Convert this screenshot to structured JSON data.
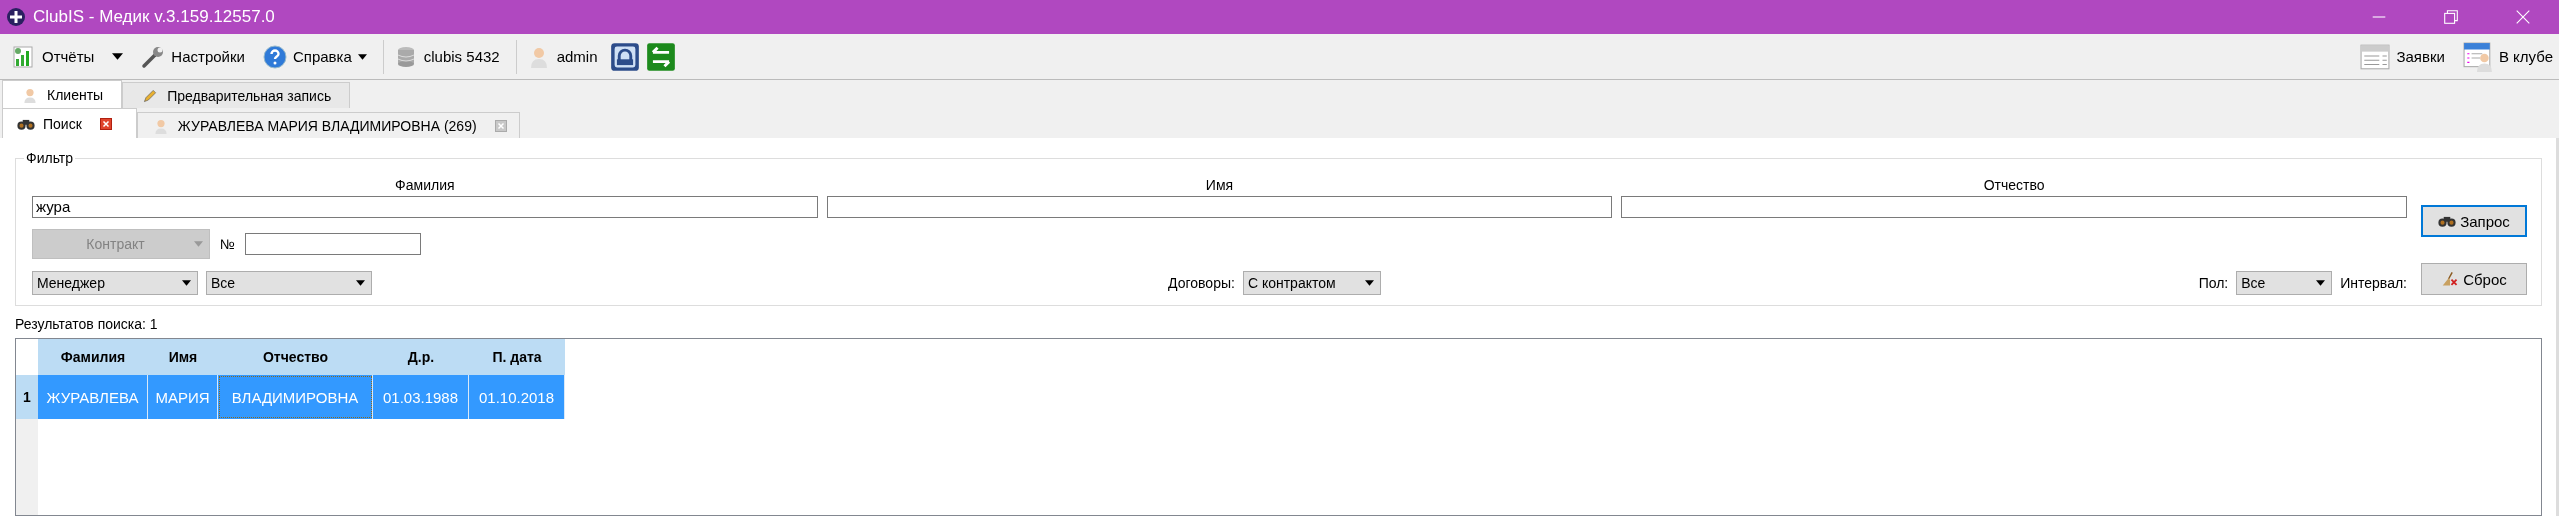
{
  "window": {
    "title": "ClubIS - Медик v.3.159.12557.0"
  },
  "toolbar": {
    "left": [
      {
        "label": "Отчёты",
        "dropdown": true
      },
      {
        "label": "Настройки",
        "dropdown": false
      },
      {
        "label": "Справка",
        "dropdown": true
      }
    ],
    "status": [
      {
        "label": "clubis 5432"
      },
      {
        "label": "admin"
      }
    ],
    "right": [
      {
        "label": "Заявки"
      },
      {
        "label": "В клубе"
      }
    ]
  },
  "main_tabs": [
    {
      "label": "Клиенты",
      "selected": true
    },
    {
      "label": "Предварительная запись",
      "selected": false
    }
  ],
  "sub_tabs": [
    {
      "label": "Поиск",
      "selected": true
    },
    {
      "label": "ЖУРАВЛЕВА МАРИЯ ВЛАДИМИРОВНА (269)",
      "selected": false
    }
  ],
  "filter": {
    "legend": "Фильтр",
    "name_fields": [
      {
        "label": "Фамилия",
        "value": "жура"
      },
      {
        "label": "Имя"
      },
      {
        "label": "Отчество"
      }
    ],
    "contract": {
      "value": "Контракт",
      "disabled": true
    },
    "number": {
      "label": "№"
    },
    "manager": {
      "value": "Менеджер"
    },
    "manager_scope": {
      "value": "Все"
    },
    "contracts": {
      "label": "Договоры:",
      "value": "С контрактом"
    },
    "gender": {
      "label": "Пол:",
      "value": "Все"
    },
    "interval": {
      "label": "Интервал:"
    },
    "buttons": [
      {
        "label": "Запрос",
        "focused": true
      },
      {
        "label": "Сброс",
        "focused": false
      }
    ]
  },
  "results": {
    "label": "Результатов поиска: 1",
    "columns": [
      "Фамилия",
      "Имя",
      "Отчество",
      "Д.р.",
      "П. дата"
    ],
    "rows": [
      {
        "number": "1",
        "selected": true,
        "cells": [
          {
            "text": "ЖУРАВЛЕВА",
            "focused": false
          },
          {
            "text": "МАРИЯ",
            "focused": false
          },
          {
            "text": "ВЛАДИМИРОВНА",
            "focused": true
          },
          {
            "text": "01.03.1988",
            "focused": false
          },
          {
            "text": "01.10.2018",
            "focused": false
          }
        ]
      }
    ]
  }
}
